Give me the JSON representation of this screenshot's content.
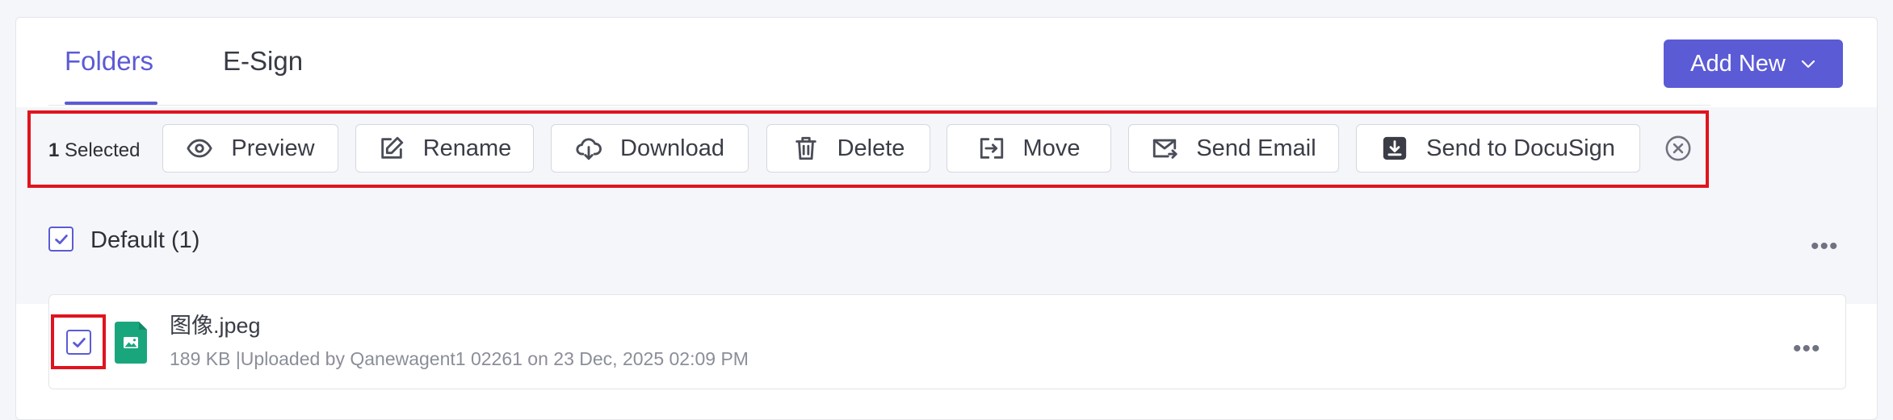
{
  "tabs": [
    {
      "label": "Folders",
      "active": true
    },
    {
      "label": "E-Sign",
      "active": false
    }
  ],
  "add_new": {
    "label": "Add New"
  },
  "bulk_actions": {
    "selected_count": "1",
    "selected_suffix": "Selected",
    "buttons": [
      {
        "label": "Preview",
        "icon": "eye-icon"
      },
      {
        "label": "Rename",
        "icon": "edit-icon"
      },
      {
        "label": "Download",
        "icon": "cloud-download-icon"
      },
      {
        "label": "Delete",
        "icon": "trash-icon"
      },
      {
        "label": "Move",
        "icon": "move-icon"
      },
      {
        "label": "Send Email",
        "icon": "mail-send-icon"
      },
      {
        "label": "Send to DocuSign",
        "icon": "download-box-icon"
      }
    ]
  },
  "group": {
    "label": "Default (1)",
    "checked": true
  },
  "files": [
    {
      "name": "图像.jpeg",
      "meta": "189 KB |Uploaded by Qanewagent1 02261 on 23 Dec, 2025 02:09 PM",
      "checked": true
    }
  ],
  "colors": {
    "accent": "#5b5bd6",
    "file_icon": "#1aa67d",
    "highlight": "#e0141e"
  }
}
